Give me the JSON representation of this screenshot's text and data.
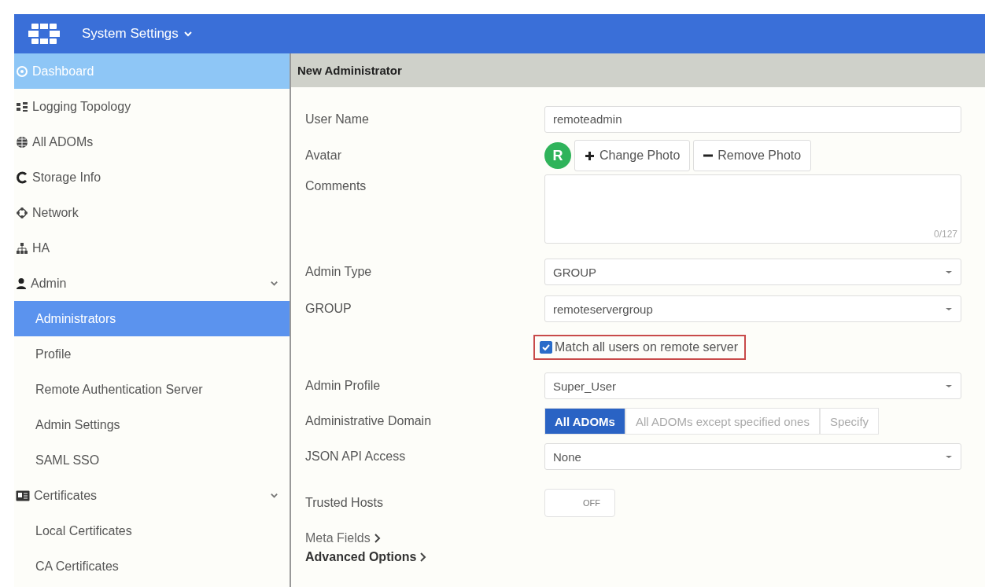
{
  "header": {
    "title": "System Settings"
  },
  "sidebar": {
    "items": [
      {
        "label": "Dashboard",
        "selected": false,
        "hovered": true
      },
      {
        "label": "Logging Topology",
        "selected": false,
        "hovered": false
      },
      {
        "label": "All ADOMs",
        "selected": false,
        "hovered": false
      },
      {
        "label": "Storage Info",
        "selected": false,
        "hovered": false
      },
      {
        "label": "Network",
        "selected": false,
        "hovered": false
      },
      {
        "label": "HA",
        "selected": false,
        "hovered": false
      },
      {
        "label": "Admin",
        "selected": false,
        "hovered": false,
        "expanded": true,
        "children": [
          {
            "label": "Administrators",
            "selected": true,
            "hovered": false
          },
          {
            "label": "Profile",
            "selected": false,
            "hovered": false
          },
          {
            "label": "Remote Authentication Server",
            "selected": false,
            "hovered": false
          },
          {
            "label": "Admin Settings",
            "selected": false,
            "hovered": false
          },
          {
            "label": "SAML SSO",
            "selected": false,
            "hovered": false
          }
        ]
      },
      {
        "label": "Certificates",
        "selected": false,
        "hovered": false,
        "expanded": true,
        "children": [
          {
            "label": "Local Certificates",
            "selected": false,
            "hovered": false
          },
          {
            "label": "CA Certificates",
            "selected": false,
            "hovered": false
          }
        ]
      }
    ]
  },
  "panel": {
    "title": "New Administrator",
    "rows": [
      {
        "kind": "text",
        "label": "User Name",
        "value": "remoteadmin"
      },
      {
        "kind": "avatar",
        "label": "Avatar",
        "initial": "R",
        "buttons": [
          "Change Photo",
          "Remove Photo"
        ]
      },
      {
        "kind": "textarea",
        "label": "Comments",
        "counter": "0/127"
      },
      {
        "kind": "select",
        "label": "Admin Type",
        "value": "GROUP"
      },
      {
        "kind": "select",
        "label": "GROUP",
        "value": "remoteservergroup"
      },
      {
        "kind": "checkbox",
        "text": "Match all users on remote server",
        "checked": true,
        "highlighted": true
      },
      {
        "kind": "select",
        "label": "Admin Profile",
        "value": "Super_User"
      },
      {
        "kind": "segmented",
        "label": "Administrative Domain",
        "options": [
          {
            "label": "All ADOMs",
            "selected": true
          },
          {
            "label": "All ADOMs except specified ones",
            "selected": false
          },
          {
            "label": "Specify",
            "selected": false
          }
        ]
      },
      {
        "kind": "select",
        "label": "JSON API Access",
        "value": "None"
      },
      {
        "kind": "toggle",
        "label": "Trusted Hosts",
        "on": false,
        "state_text": "OFF"
      }
    ],
    "links": [
      {
        "label": "Meta Fields",
        "bold": false
      },
      {
        "label": "Advanced Options",
        "bold": true
      }
    ]
  }
}
